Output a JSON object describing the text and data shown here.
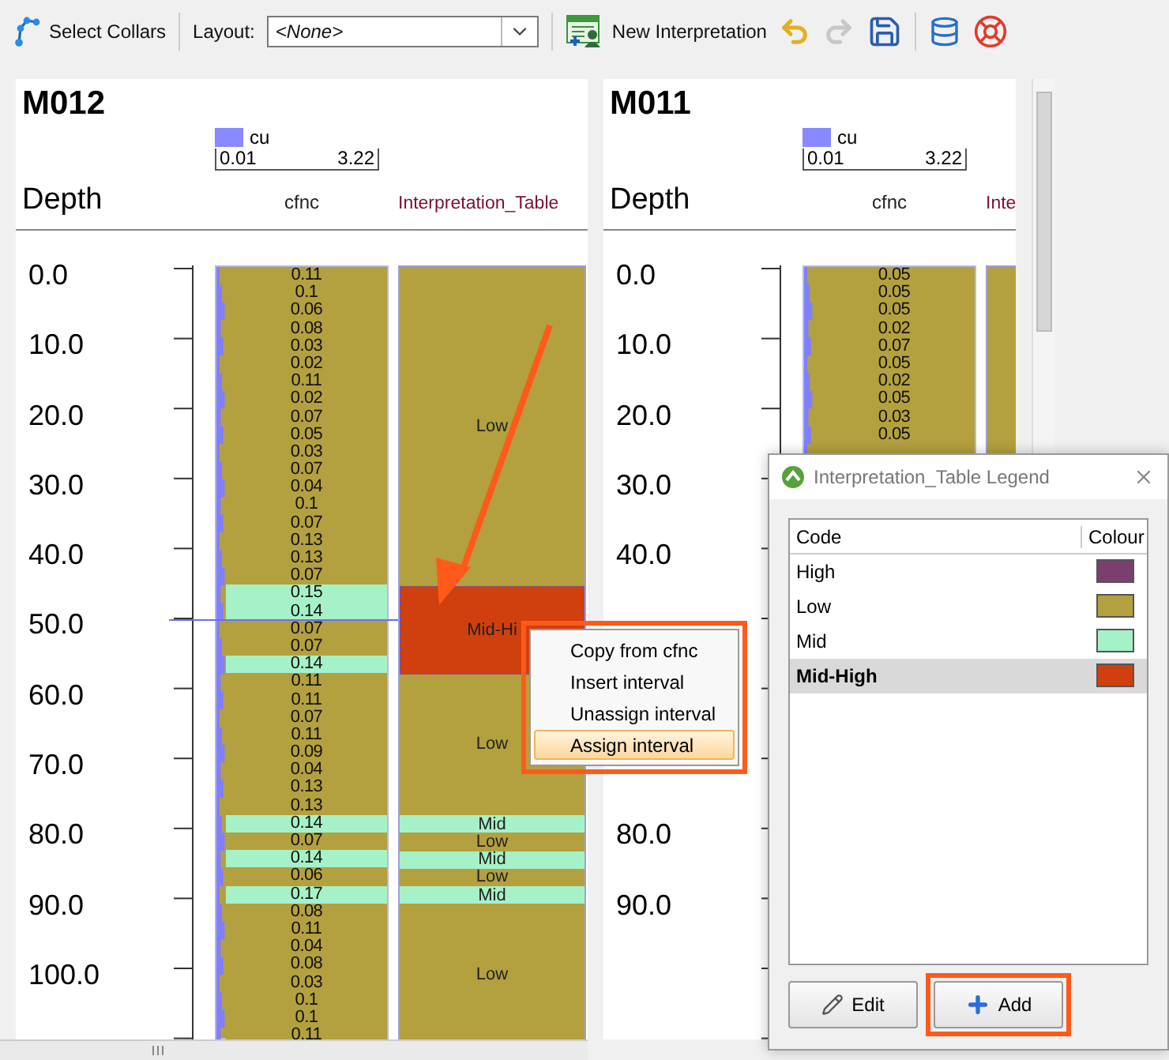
{
  "toolbar": {
    "select_collars": "Select Collars",
    "layout_label": "Layout:",
    "layout_value": "<None>",
    "new_interpretation": "New Interpretation"
  },
  "logs": [
    {
      "hole": "M012",
      "legend": {
        "name": "cu",
        "min": "0.01",
        "max": "3.22"
      },
      "depth_header": "Depth",
      "columns": [
        "cfnc",
        "Interpretation_Table"
      ],
      "depths": [
        "0.0",
        "10.0",
        "20.0",
        "30.0",
        "40.0",
        "50.0",
        "60.0",
        "70.0",
        "80.0",
        "90.0",
        "100.0"
      ],
      "samples": [
        {
          "value": "0.11",
          "color": "#b3a03f"
        },
        {
          "value": "0.1",
          "color": "#b3a03f"
        },
        {
          "value": "0.06",
          "color": "#b3a03f"
        },
        {
          "value": "0.08",
          "color": "#b3a03f"
        },
        {
          "value": "0.03",
          "color": "#b3a03f"
        },
        {
          "value": "0.02",
          "color": "#b3a03f"
        },
        {
          "value": "0.11",
          "color": "#b3a03f"
        },
        {
          "value": "0.02",
          "color": "#b3a03f"
        },
        {
          "value": "0.07",
          "color": "#b3a03f"
        },
        {
          "value": "0.05",
          "color": "#b3a03f"
        },
        {
          "value": "0.03",
          "color": "#b3a03f"
        },
        {
          "value": "0.07",
          "color": "#b3a03f"
        },
        {
          "value": "0.04",
          "color": "#b3a03f"
        },
        {
          "value": "0.1",
          "color": "#b3a03f"
        },
        {
          "value": "0.07",
          "color": "#b3a03f"
        },
        {
          "value": "0.13",
          "color": "#b3a03f"
        },
        {
          "value": "0.13",
          "color": "#b3a03f"
        },
        {
          "value": "0.07",
          "color": "#b3a03f"
        },
        {
          "value": "0.15",
          "color": "#a6f2c8"
        },
        {
          "value": "0.14",
          "color": "#a6f2c8"
        },
        {
          "value": "0.07",
          "color": "#b3a03f"
        },
        {
          "value": "0.07",
          "color": "#b3a03f"
        },
        {
          "value": "0.14",
          "color": "#a6f2c8"
        },
        {
          "value": "0.11",
          "color": "#b3a03f"
        },
        {
          "value": "0.11",
          "color": "#b3a03f"
        },
        {
          "value": "0.07",
          "color": "#b3a03f"
        },
        {
          "value": "0.11",
          "color": "#b3a03f"
        },
        {
          "value": "0.09",
          "color": "#b3a03f"
        },
        {
          "value": "0.04",
          "color": "#b3a03f"
        },
        {
          "value": "0.13",
          "color": "#b3a03f"
        },
        {
          "value": "0.13",
          "color": "#b3a03f"
        },
        {
          "value": "0.14",
          "color": "#a6f2c8"
        },
        {
          "value": "0.07",
          "color": "#b3a03f"
        },
        {
          "value": "0.14",
          "color": "#a6f2c8"
        },
        {
          "value": "0.06",
          "color": "#b3a03f"
        },
        {
          "value": "0.17",
          "color": "#a6f2c8"
        },
        {
          "value": "0.08",
          "color": "#b3a03f"
        },
        {
          "value": "0.11",
          "color": "#b3a03f"
        },
        {
          "value": "0.04",
          "color": "#b3a03f"
        },
        {
          "value": "0.08",
          "color": "#b3a03f"
        },
        {
          "value": "0.03",
          "color": "#b3a03f"
        },
        {
          "value": "0.1",
          "color": "#b3a03f"
        },
        {
          "value": "0.1",
          "color": "#b3a03f"
        },
        {
          "value": "0.11",
          "color": "#b3a03f"
        }
      ],
      "intervals": [
        {
          "label": "Low",
          "color": "#b3a03f",
          "selected": false
        },
        {
          "label": "Mid-Hi",
          "color": "#d0400e",
          "selected": true
        },
        {
          "label": "Low",
          "color": "#b3a03f",
          "selected": false
        },
        {
          "label": "Mid",
          "color": "#a6f2c8",
          "selected": false
        },
        {
          "label": "Low",
          "color": "#b3a03f",
          "selected": false
        },
        {
          "label": "Mid",
          "color": "#a6f2c8",
          "selected": false
        },
        {
          "label": "Low",
          "color": "#b3a03f",
          "selected": false
        },
        {
          "label": "Mid",
          "color": "#a6f2c8",
          "selected": false
        },
        {
          "label": "Low",
          "color": "#b3a03f",
          "selected": false
        }
      ]
    },
    {
      "hole": "M011",
      "legend": {
        "name": "cu",
        "min": "0.01",
        "max": "3.22"
      },
      "depth_header": "Depth",
      "columns": [
        "cfnc",
        "Inte"
      ],
      "depths": [
        "0.0",
        "10.0",
        "20.0",
        "30.0",
        "40.0"
      ],
      "lower_depths": [
        "80.0",
        "90.0"
      ],
      "samples": [
        {
          "value": "0.05",
          "color": "#b3a03f"
        },
        {
          "value": "0.05",
          "color": "#b3a03f"
        },
        {
          "value": "0.05",
          "color": "#b3a03f"
        },
        {
          "value": "0.02",
          "color": "#b3a03f"
        },
        {
          "value": "0.07",
          "color": "#b3a03f"
        },
        {
          "value": "0.05",
          "color": "#b3a03f"
        },
        {
          "value": "0.02",
          "color": "#b3a03f"
        },
        {
          "value": "0.05",
          "color": "#b3a03f"
        },
        {
          "value": "0.03",
          "color": "#b3a03f"
        },
        {
          "value": "0.05",
          "color": "#b3a03f"
        }
      ],
      "intervals": [
        {
          "color": "#b3a03f",
          "selected": false
        }
      ]
    }
  ],
  "context_menu": [
    {
      "label": "Copy from cfnc",
      "selected": false
    },
    {
      "label": "Insert interval",
      "selected": false
    },
    {
      "label": "Unassign interval",
      "selected": false
    },
    {
      "label": "Assign interval",
      "selected": true
    }
  ],
  "legend_dialog": {
    "title": "Interpretation_Table Legend",
    "columns": [
      "Code",
      "Colour"
    ],
    "rows": [
      {
        "code": "High",
        "color": "#7a3f6f",
        "selected": false
      },
      {
        "code": "Low",
        "color": "#b3a03f",
        "selected": false
      },
      {
        "code": "Mid",
        "color": "#a6f2c8",
        "selected": false
      },
      {
        "code": "Mid-High",
        "color": "#d0400e",
        "selected": true
      }
    ],
    "buttons": [
      "Edit",
      "Add"
    ]
  }
}
